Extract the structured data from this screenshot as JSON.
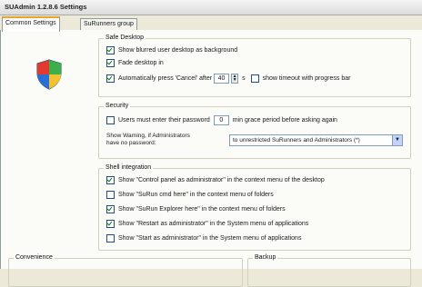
{
  "window": {
    "title": "SUAdmin 1.2.8.6 Settings"
  },
  "tabs": [
    {
      "label": "Common Settings"
    },
    {
      "label": "SuRunners group"
    }
  ],
  "safe_desktop": {
    "legend": "Safe Desktop",
    "blurred_bg": "Show blurred user desktop as background",
    "fade": "Fade desktop in",
    "auto_cancel_prefix": "Automatically press 'Cancel' after",
    "auto_cancel_value": "40",
    "auto_cancel_unit": "s",
    "show_timeout": "show timeout with progress bar"
  },
  "security": {
    "legend": "Security",
    "password_prefix": "Users must enter their password",
    "password_value": "0",
    "password_suffix": "min grace period before asking again",
    "warning_label_1": "Show Warning, if Administrators",
    "warning_label_2": "have no password:",
    "warning_select": "to unrestricted SuRunners and Administrators (*)"
  },
  "shell": {
    "legend": "Shell integration",
    "items": [
      "Show \"Control panel as administrator\" in the context menu of the desktop",
      "Show \"SuRun cmd here\" in the context menu of folders",
      "Show \"SuRun Explorer here\" in the context menu of folders",
      "Show \"Restart as administrator\" in the System menu of applications",
      "Show \"Start as administrator\" in the System menu of applications"
    ]
  },
  "bottom": {
    "convenience_legend": "Convenience",
    "backup_legend": "Backup"
  }
}
